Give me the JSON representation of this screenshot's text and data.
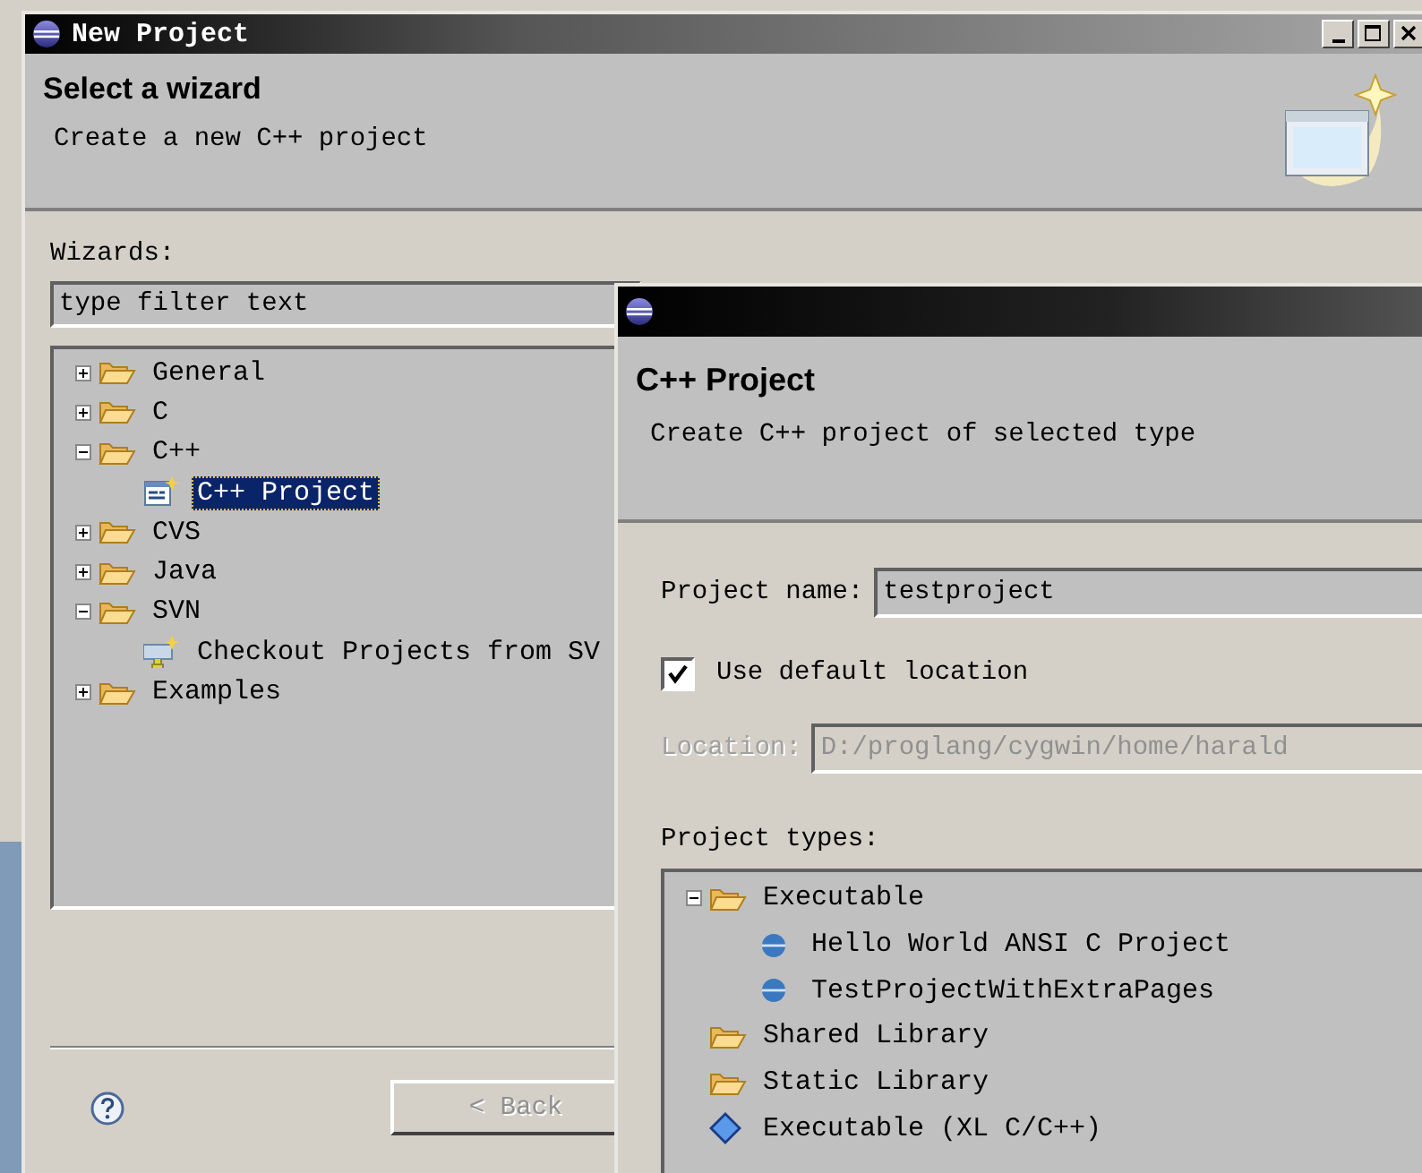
{
  "main_window": {
    "title": "New Project",
    "header": {
      "title": "Select a wizard",
      "description": "Create a new C++ project"
    },
    "wizards_label": "Wizards:",
    "filter": {
      "placeholder": "type filter text"
    },
    "tree": [
      {
        "label": "General",
        "kind": "folder",
        "expanded": false,
        "selected": false
      },
      {
        "label": "C",
        "kind": "folder",
        "expanded": false,
        "selected": false
      },
      {
        "label": "C++",
        "kind": "folder",
        "expanded": true,
        "selected": false,
        "children": [
          {
            "label": "C++ Project",
            "kind": "cpp-wizard",
            "selected": true
          }
        ]
      },
      {
        "label": "CVS",
        "kind": "folder",
        "expanded": false,
        "selected": false
      },
      {
        "label": "Java",
        "kind": "folder",
        "expanded": false,
        "selected": false
      },
      {
        "label": "SVN",
        "kind": "folder",
        "expanded": true,
        "selected": false,
        "children": [
          {
            "label": "Checkout Projects from SV",
            "kind": "svn-wizard",
            "selected": false
          }
        ]
      },
      {
        "label": "Examples",
        "kind": "folder",
        "expanded": false,
        "selected": false
      }
    ],
    "back_button": {
      "label": "< Back",
      "disabled": true
    }
  },
  "sub_dialog": {
    "header": {
      "title": "C++ Project",
      "description": "Create C++ project of selected type"
    },
    "project_name": {
      "label": "Project name:",
      "value": "testproject"
    },
    "default_location": {
      "label": "Use default location",
      "checked": true
    },
    "location": {
      "label": "Location:",
      "value": "D:/proglang/cygwin/home/harald",
      "disabled": true
    },
    "project_types_label": "Project types:",
    "project_types": [
      {
        "label": "Executable",
        "kind": "folder",
        "expanded": true,
        "selected": false,
        "children": [
          {
            "label": "Hello World ANSI C Project",
            "kind": "template",
            "selected": false
          },
          {
            "label": "TestProjectWithExtraPages",
            "kind": "template",
            "selected": false
          }
        ]
      },
      {
        "label": "Shared Library",
        "kind": "folder",
        "selected": false
      },
      {
        "label": "Static Library",
        "kind": "folder",
        "selected": false
      },
      {
        "label": "Executable (XL C/C++)",
        "kind": "toolchain",
        "selected": false
      }
    ]
  }
}
